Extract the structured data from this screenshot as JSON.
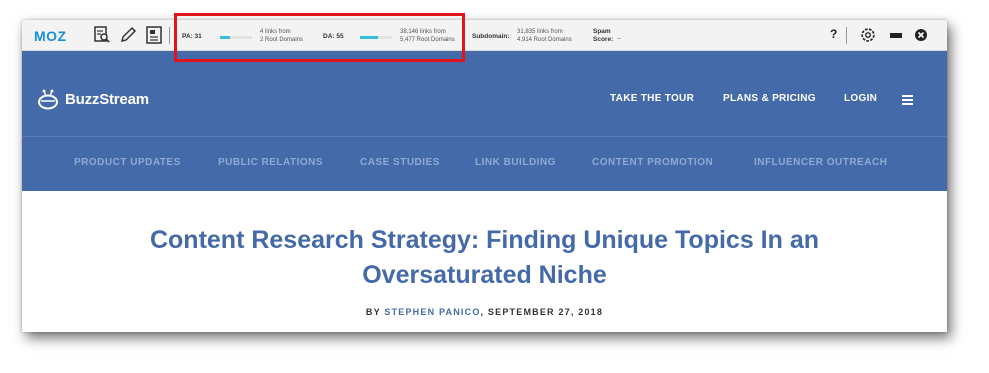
{
  "mozbar": {
    "logo": "MOZ",
    "pa_label": "PA: 31",
    "pa_links": "4 links from",
    "pa_domains": "2 Root Domains",
    "pa_fill": 0.31,
    "da_label": "DA: 55",
    "da_links": "38,146 links from",
    "da_domains": "5,477 Root Domains",
    "da_fill": 0.55,
    "subdomain_label": "Subdomain:",
    "subdomain_links": "31,835 links from",
    "subdomain_domains": "4,914 Root Domains",
    "spam_label": "Spam",
    "spam_label2": "Score:",
    "spam_value": "--",
    "help": "?",
    "icons": [
      "page-analysis-icon",
      "highlight-pencil-icon",
      "serp-icon",
      "settings-gear-icon",
      "minimize-icon",
      "close-icon"
    ],
    "accent_color": "#38bfd8"
  },
  "site": {
    "brand": "BuzzStream",
    "nav": [
      "TAKE THE TOUR",
      "PLANS & PRICING",
      "LOGIN"
    ],
    "subnav": [
      "PRODUCT UPDATES",
      "PUBLIC RELATIONS",
      "CASE STUDIES",
      "LINK BUILDING",
      "CONTENT PROMOTION",
      "INFLUENCER OUTREACH"
    ],
    "header_color": "#456aa9"
  },
  "article": {
    "title_line1": "Content Research Strategy: Finding Unique Topics In an",
    "title_line2": "Oversaturated Niche",
    "by": "BY ",
    "author": "STEPHEN PANICO",
    "date": ", SEPTEMBER 27, 2018"
  }
}
